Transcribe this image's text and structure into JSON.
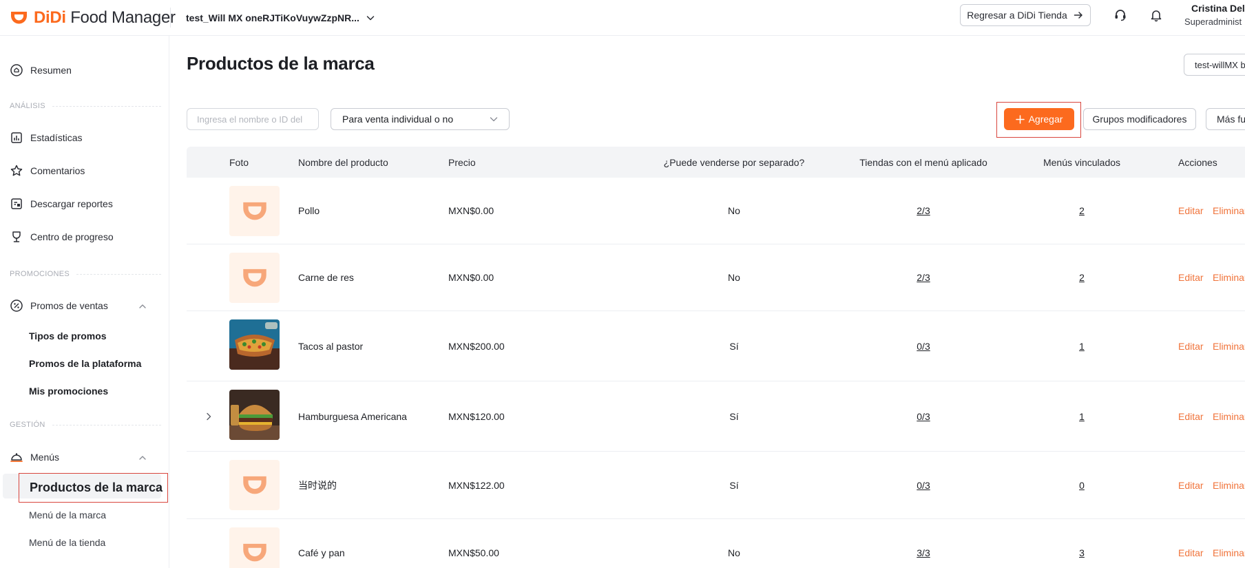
{
  "header": {
    "logo_brand": "DiDi",
    "logo_app": "Food Manager",
    "store_name": "test_Will MX oneRJTiKoVuywZzpNR...",
    "return_label": "Regresar a DiDi Tienda",
    "user_name": "Cristina Del",
    "user_role": "Superadminist"
  },
  "sidebar": {
    "summary": "Resumen",
    "section_analysis": "ANÁLISIS",
    "stats": "Estadísticas",
    "comments": "Comentarios",
    "reports": "Descargar reportes",
    "progress": "Centro de progreso",
    "section_promotions": "PROMOCIONES",
    "sales_promos": "Promos de ventas",
    "promo_types": "Tipos de promos",
    "platform_promos": "Promos de la plataforma",
    "my_promos": "Mis promociones",
    "section_management": "GESTIÓN",
    "menus": "Menús",
    "brand_products": "Productos de la marca",
    "brand_menu": "Menú de la marca",
    "store_menu": "Menú de la tienda"
  },
  "main": {
    "title": "Productos de la marca",
    "brand_selector": "test-willMX b",
    "search_placeholder": "Ingresa el nombre o ID del",
    "sale_filter": "Para venta individual o no",
    "add_label": "Agregar",
    "modifier_groups_label": "Grupos modificadores",
    "more_label": "Más fun"
  },
  "table": {
    "columns": {
      "photo": "Foto",
      "name": "Nombre del producto",
      "price": "Precio",
      "separate": "¿Puede venderse por separado?",
      "stores": "Tiendas con el menú aplicado",
      "menus": "Menús vinculados",
      "actions": "Acciones"
    },
    "edit_label": "Editar",
    "delete_label": "Eliminar",
    "rows": [
      {
        "name": "Pollo",
        "price": "MXN$0.00",
        "separate": "No",
        "stores": "2/3",
        "menus": "2",
        "photo": "placeholder"
      },
      {
        "name": "Carne de res",
        "price": "MXN$0.00",
        "separate": "No",
        "stores": "2/3",
        "menus": "2",
        "photo": "placeholder"
      },
      {
        "name": "Tacos al pastor",
        "price": "MXN$200.00",
        "separate": "Sí",
        "stores": "0/3",
        "menus": "1",
        "photo": "tacos-photo"
      },
      {
        "name": "Hamburguesa Americana",
        "price": "MXN$120.00",
        "separate": "Sí",
        "stores": "0/3",
        "menus": "1",
        "photo": "burger-photo"
      },
      {
        "name": "当时说的",
        "price": "MXN$122.00",
        "separate": "Sí",
        "stores": "0/3",
        "menus": "0",
        "photo": "placeholder"
      },
      {
        "name": "Café y pan",
        "price": "MXN$50.00",
        "separate": "No",
        "stores": "3/3",
        "menus": "3",
        "photo": "placeholder"
      }
    ]
  },
  "colors": {
    "accent": "#fc6a1e",
    "action_link": "#f0733a",
    "highlight_outline": "#d8443c"
  }
}
